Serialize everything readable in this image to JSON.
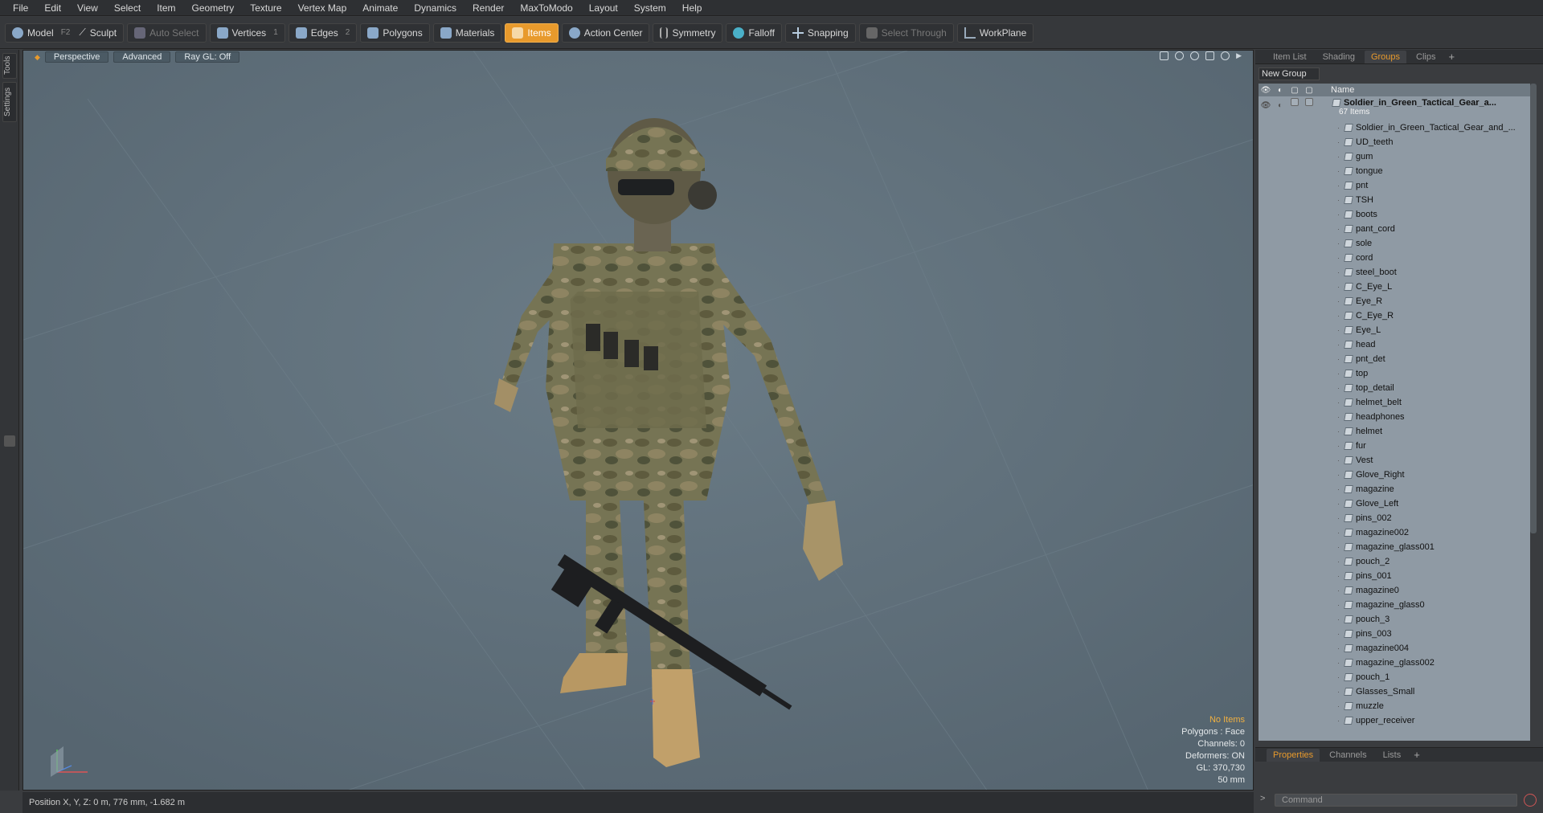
{
  "menu": [
    "File",
    "Edit",
    "View",
    "Select",
    "Item",
    "Geometry",
    "Texture",
    "Vertex Map",
    "Animate",
    "Dynamics",
    "Render",
    "MaxToModo",
    "Layout",
    "System",
    "Help"
  ],
  "toolbar": {
    "model": "Model",
    "model_key": "F2",
    "sculpt": "Sculpt",
    "auto_select": "Auto Select",
    "vertices": "Vertices",
    "vertices_key": "1",
    "edges": "Edges",
    "edges_key": "2",
    "polygons": "Polygons",
    "materials": "Materials",
    "items": "Items",
    "action_center": "Action Center",
    "symmetry": "Symmetry",
    "falloff": "Falloff",
    "snapping": "Snapping",
    "select_through": "Select Through",
    "workplane": "WorkPlane"
  },
  "left_tabs": {
    "tools": "Tools",
    "settings": "Settings"
  },
  "viewport": {
    "view": "Perspective",
    "shading": "Advanced",
    "raygl": "Ray GL: Off",
    "hud": {
      "items": "No Items",
      "polygons": "Polygons : Face",
      "channels": "Channels: 0",
      "deformers": "Deformers: ON",
      "gl": "GL: 370,730",
      "lens": "50 mm"
    }
  },
  "status": {
    "position": "Position X, Y, Z:   0 m, 776 mm, -1.682 m"
  },
  "right_panel": {
    "tabs": [
      "Item List",
      "Shading",
      "Groups",
      "Clips"
    ],
    "active_tab": "Groups",
    "new_group": "New Group",
    "column_name": "Name",
    "group": {
      "name": "Soldier_in_Green_Tactical_Gear_a...",
      "count": "67 Items"
    },
    "items": [
      "Soldier_in_Green_Tactical_Gear_and_...",
      "UD_teeth",
      "gum",
      "tongue",
      "pnt",
      "TSH",
      "boots",
      "pant_cord",
      "sole",
      "cord",
      "steel_boot",
      "C_Eye_L",
      "Eye_R",
      "C_Eye_R",
      "Eye_L",
      "head",
      "pnt_det",
      "top",
      "top_detail",
      "helmet_belt",
      "headphones",
      "helmet",
      "fur",
      "Vest",
      "Glove_Right",
      "magazine",
      "Glove_Left",
      "pins_002",
      "magazine002",
      "magazine_glass001",
      "pouch_2",
      "pins_001",
      "magazine0",
      "magazine_glass0",
      "pouch_3",
      "pins_003",
      "magazine004",
      "magazine_glass002",
      "pouch_1",
      "Glasses_Small",
      "muzzle",
      "upper_receiver"
    ],
    "bottom_tabs": [
      "Properties",
      "Channels",
      "Lists"
    ],
    "bottom_active": "Properties",
    "command_placeholder": "Command"
  },
  "colors": {
    "accent": "#e89a2c",
    "viewport_bg": "#5f6f7a",
    "camo": "#6b6a4e"
  }
}
